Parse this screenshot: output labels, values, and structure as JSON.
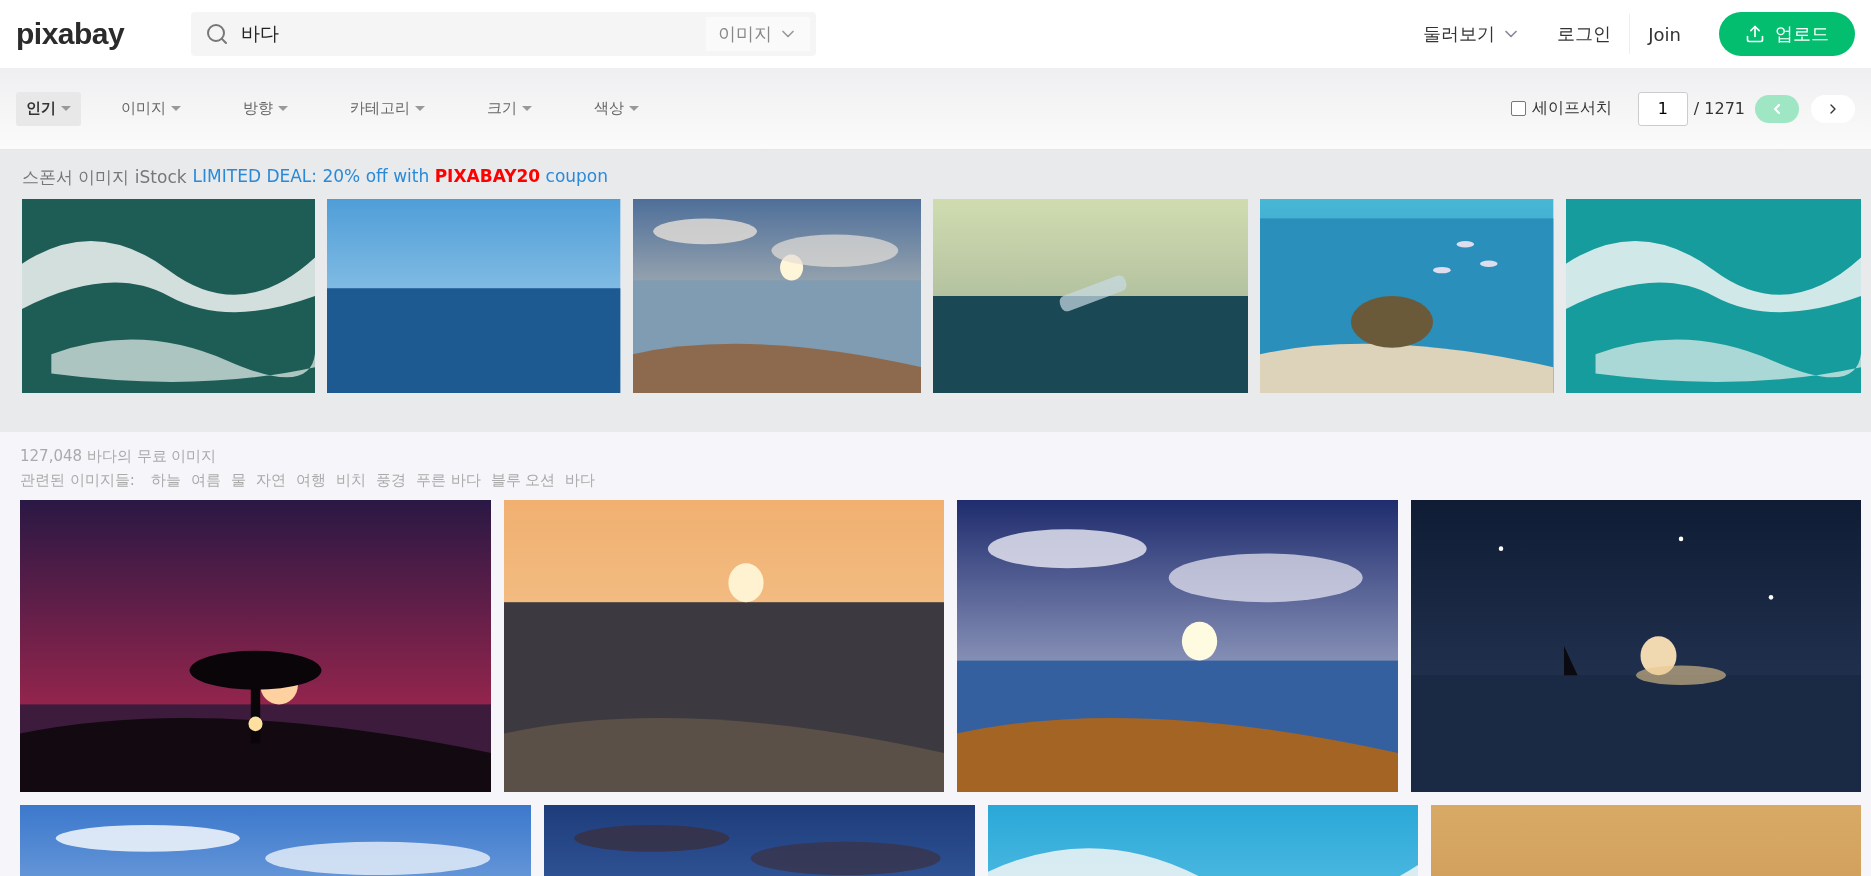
{
  "header": {
    "logo": "pixabay",
    "search": {
      "value": "바다",
      "type_label": "이미지"
    },
    "nav": [
      {
        "label": "둘러보기",
        "kind": "dropdown"
      },
      {
        "label": "로그인",
        "kind": "link"
      },
      {
        "label": "Join",
        "kind": "link"
      }
    ],
    "upload_button": "업로드"
  },
  "filters": [
    {
      "label": "인기",
      "selected": true
    },
    {
      "label": "이미지",
      "selected": false
    },
    {
      "label": "방향",
      "selected": false
    },
    {
      "label": "카테고리",
      "selected": false
    },
    {
      "label": "크기",
      "selected": false
    },
    {
      "label": "색상",
      "selected": false
    }
  ],
  "safe_search": {
    "label": "세이프서치",
    "checked": false
  },
  "pagination": {
    "page": "1",
    "total": "/ 1271",
    "prev_disabled": true,
    "next_disabled": false
  },
  "sponsored": {
    "label": "스폰서 이미지 iStock",
    "link": "LIMITED DEAL: 20% off with **PIXABAY20** coupon"
  },
  "results": {
    "count": "127,048 바다의 무료 이미지",
    "related_label": "관련된 이미지들:",
    "related": [
      "하늘",
      "여름",
      "물",
      "자연",
      "여행",
      "비치",
      "풍경",
      "푸른 바다",
      "블루 오션",
      "바다"
    ]
  }
}
